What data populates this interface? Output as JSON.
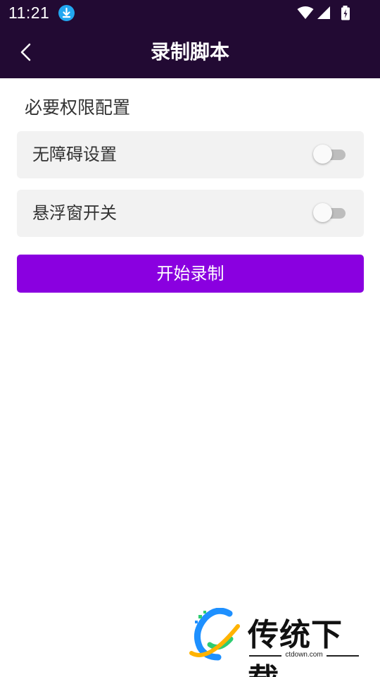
{
  "status_bar": {
    "time": "11:21",
    "icons": [
      "download-notification-icon",
      "wifi-icon",
      "cellular-signal-icon",
      "battery-charging-icon"
    ],
    "background": "#220a33"
  },
  "app_bar": {
    "title": "录制脚本",
    "back_icon": "chevron-left-icon",
    "background": "#220a33"
  },
  "permissions": {
    "section_title": "必要权限配置",
    "items": [
      {
        "label": "无障碍设置",
        "enabled": false
      },
      {
        "label": "悬浮窗开关",
        "enabled": false
      }
    ]
  },
  "actions": {
    "start_recording_label": "开始录制",
    "accent_color": "#8a00e0"
  },
  "watermark": {
    "title": "传统下载",
    "url": "ctdown.com"
  }
}
